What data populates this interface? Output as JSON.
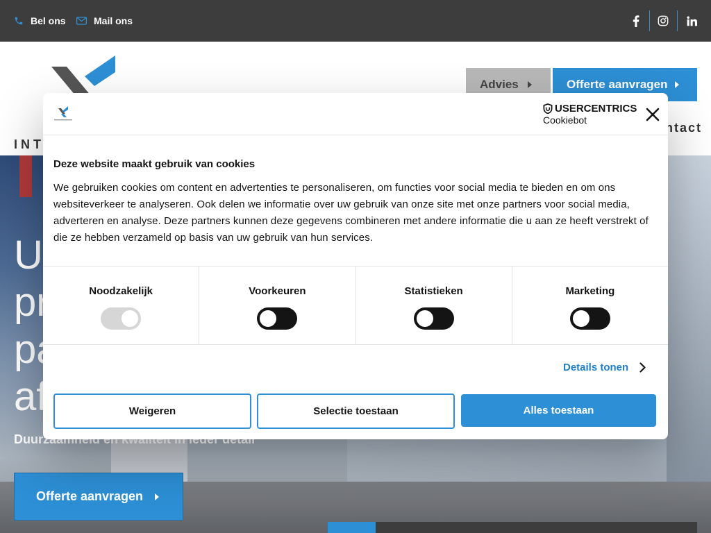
{
  "topbar": {
    "phone_label": "Bel ons",
    "mail_label": "Mail ons",
    "social": [
      "facebook-icon",
      "instagram-icon",
      "linkedin-icon"
    ]
  },
  "header": {
    "logo_text": "INT",
    "advies_label": "Advies",
    "offerte_label": "Offerte aanvragen",
    "nav_contact": "ntact"
  },
  "hero": {
    "title": "U\npr\npa\naf",
    "subtitle": "Duurzaamheid en kwaliteit in ieder detail",
    "cta_label": "Offerte aanvragen"
  },
  "cookie_dialog": {
    "brand_top": "USERCENTRICS",
    "brand_bottom": "Cookiebot",
    "title": "Deze website maakt gebruik van cookies",
    "text": "We gebruiken cookies om content en advertenties te personaliseren, om functies voor social media te bieden en om ons websiteverkeer te analyseren. Ook delen we informatie over uw gebruik van onze site met onze partners voor social media, adverteren en analyse. Deze partners kunnen deze gegevens combineren met andere informatie die u aan ze heeft verstrekt of die ze hebben verzameld op basis van uw gebruik van hun services.",
    "categories": [
      {
        "label": "Noodzakelijk",
        "enabled": true,
        "locked": true
      },
      {
        "label": "Voorkeuren",
        "enabled": false,
        "locked": false
      },
      {
        "label": "Statistieken",
        "enabled": false,
        "locked": false
      },
      {
        "label": "Marketing",
        "enabled": false,
        "locked": false
      }
    ],
    "details_label": "Details tonen",
    "buttons": {
      "deny": "Weigeren",
      "allow_selection": "Selectie toestaan",
      "allow_all": "Alles toestaan"
    }
  },
  "colors": {
    "accent": "#2d8fd5",
    "topbar": "#3d3d3d",
    "text": "#141414"
  }
}
